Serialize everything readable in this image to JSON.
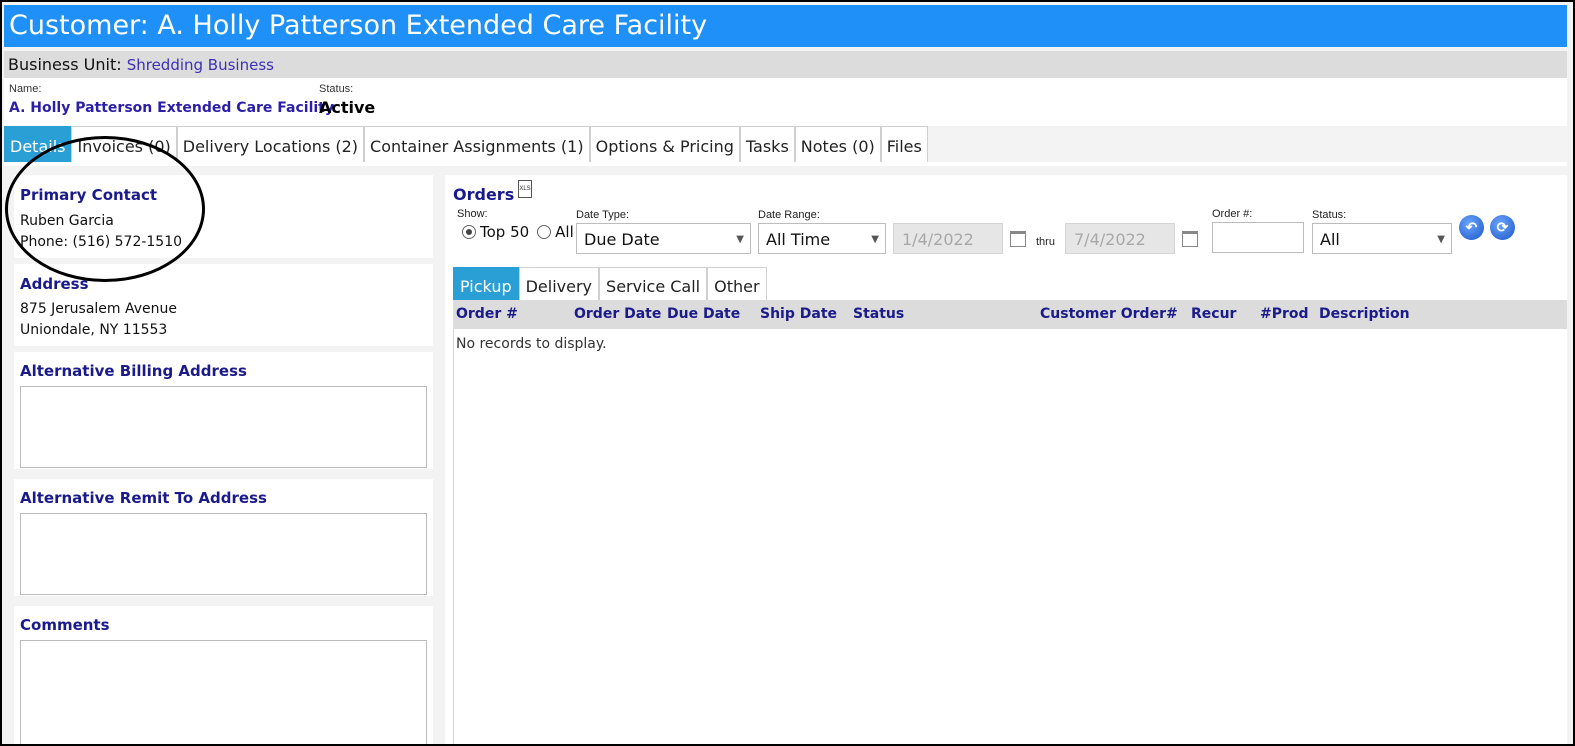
{
  "header": {
    "title": "Customer: A. Holly Patterson Extended Care Facility"
  },
  "business_unit": {
    "label": "Business Unit:",
    "value": "Shredding Business"
  },
  "info": {
    "name_label": "Name:",
    "name_value": "A. Holly Patterson Extended Care Facility",
    "status_label": "Status:",
    "status_value": "Active"
  },
  "tabs": [
    {
      "label": "Details",
      "active": true
    },
    {
      "label": "Invoices (0)"
    },
    {
      "label": "Delivery Locations (2)"
    },
    {
      "label": "Container Assignments (1)"
    },
    {
      "label": "Options & Pricing"
    },
    {
      "label": "Tasks"
    },
    {
      "label": "Notes (0)"
    },
    {
      "label": "Files"
    }
  ],
  "primary_contact": {
    "title": "Primary Contact",
    "name": "Ruben Garcia",
    "phone": "Phone: (516) 572-1510"
  },
  "address": {
    "title": "Address",
    "line1": "875 Jerusalem Avenue",
    "line2": "Uniondale, NY 11553"
  },
  "alt_billing": {
    "title": "Alternative Billing Address"
  },
  "alt_remit": {
    "title": "Alternative Remit To Address"
  },
  "comments": {
    "title": "Comments"
  },
  "orders": {
    "title": "Orders",
    "xls_icon_text": "XLS",
    "show_label": "Show:",
    "top50_label": "Top 50",
    "all_label": "All",
    "date_type_label": "Date Type:",
    "date_type_value": "Due Date",
    "date_range_label": "Date Range:",
    "date_range_value": "All Time",
    "date_from": "1/4/2022",
    "thru_label": "thru",
    "date_to": "7/4/2022",
    "order_num_label": "Order #:",
    "status_label": "Status:",
    "status_value": "All",
    "subtabs": [
      "Pickup",
      "Delivery",
      "Service Call",
      "Other"
    ],
    "columns": [
      "Order #",
      "Order Date",
      "Due Date",
      "Ship Date",
      "Status",
      "Customer Order#",
      "Recur",
      "#Prod",
      "Description"
    ],
    "empty_message": "No records to display."
  },
  "colors": {
    "title_bar": "#1e90f7",
    "tab_active": "#2a9fd6",
    "heading": "#1a1a8a",
    "link": "#3d2fb3"
  }
}
